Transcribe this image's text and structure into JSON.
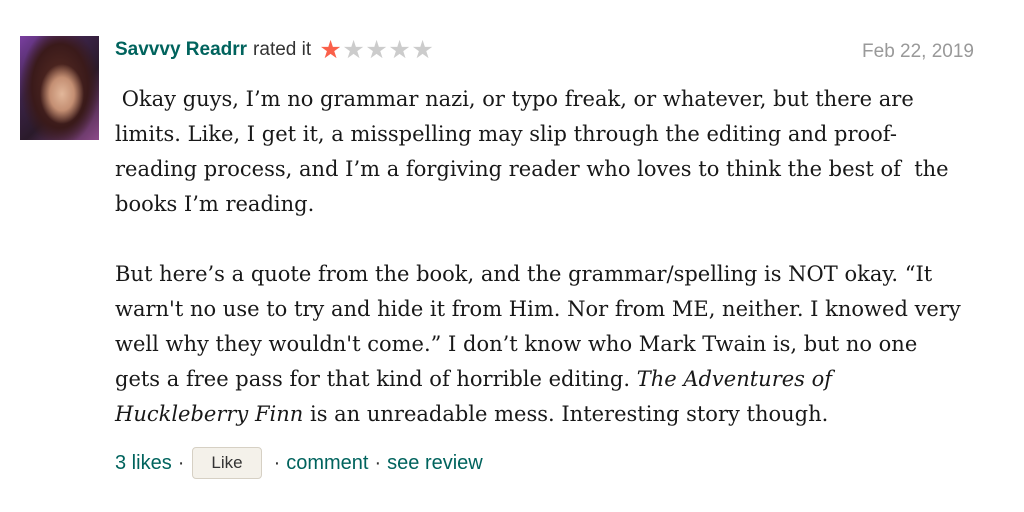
{
  "review": {
    "reviewer_name": "Savvvy Readrr",
    "rated_text": "rated it",
    "rating": 1,
    "rating_max": 5,
    "date": "Feb 22, 2019",
    "paragraph1": " Okay guys, I’m no grammar nazi, or typo freak, or whatever, but there are limits. Like, I get it, a misspelling may slip through the editing and proof-reading process, and I’m a forgiving reader who loves to think the best of  the books I’m reading.",
    "paragraph2_before": "But here’s a quote from the book, and the grammar/spelling is NOT okay. “It warn't no use to try and hide it from Him. Nor from ME, neither. I knowed very well why they wouldn't come.” I don’t know who Mark Twain is, but no one gets a free pass for that kind of horrible editing. ",
    "paragraph2_title": "The Adventures of Huckleberry Finn",
    "paragraph2_after": " is an unreadable mess. Interesting story though.",
    "likes_text": "3 likes",
    "like_button_label": "Like",
    "comment_link": "comment",
    "see_review_link": "see review",
    "separator": "·"
  },
  "colors": {
    "link": "#00635d",
    "star_on": "#fa604a",
    "star_off": "#cccccc",
    "date": "#999999"
  },
  "icons": {
    "avatar": "reviewer-portrait",
    "star": "star-icon"
  }
}
